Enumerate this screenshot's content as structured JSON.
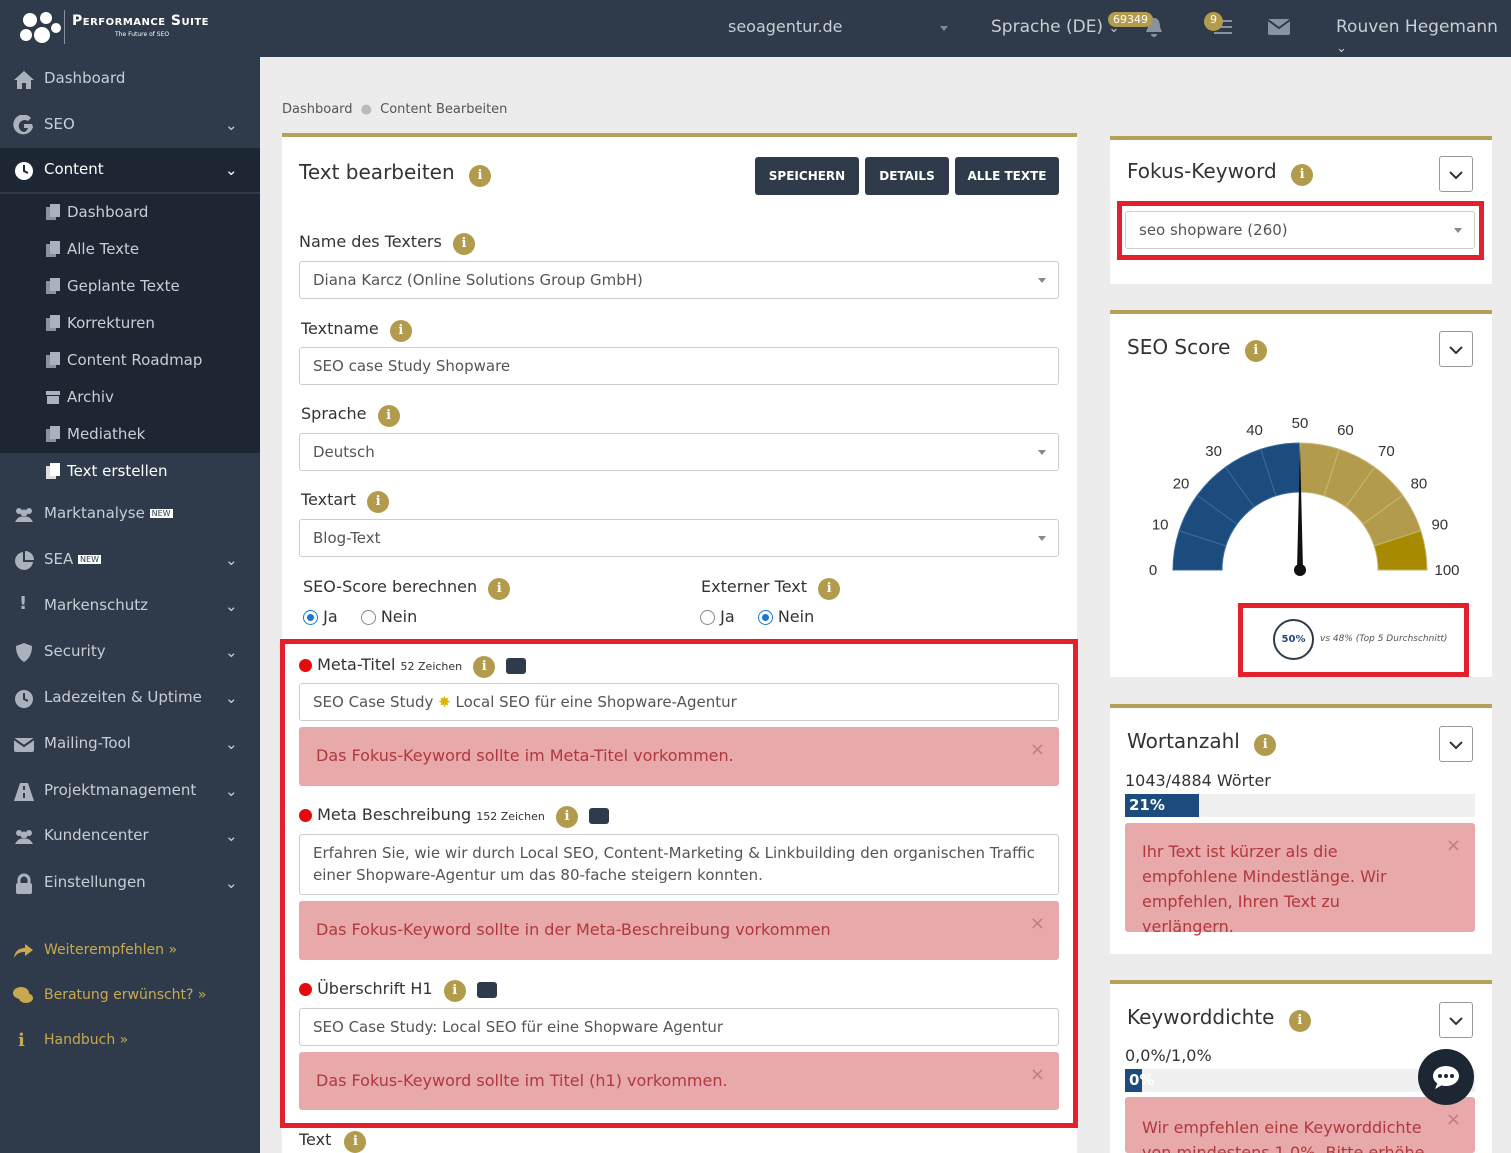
{
  "topbar": {
    "logo_title": "Performance Suite",
    "logo_subtitle": "The Future of SEO",
    "domain": "seoagentur.de",
    "language": "Sprache (DE)",
    "notif_count": "69349",
    "task_count": "9",
    "user": "Rouven Hegemann"
  },
  "sidebar": {
    "items": [
      {
        "label": "Dashboard",
        "icon": "home-icon"
      },
      {
        "label": "SEO",
        "icon": "google-icon"
      },
      {
        "label": "Content",
        "icon": "clock-icon"
      },
      {
        "label": "Marktanalyse",
        "icon": "users-icon",
        "badge": "NEW"
      },
      {
        "label": "SEA",
        "icon": "pie-chart-icon",
        "badge": "NEW"
      },
      {
        "label": "Markenschutz",
        "icon": "exclamation-icon"
      },
      {
        "label": "Security",
        "icon": "shield-icon"
      },
      {
        "label": "Ladezeiten & Uptime",
        "icon": "clock-icon"
      },
      {
        "label": "Mailing-Tool",
        "icon": "envelope-icon"
      },
      {
        "label": "Projektmanagement",
        "icon": "road-icon"
      },
      {
        "label": "Kundencenter",
        "icon": "users-icon"
      },
      {
        "label": "Einstellungen",
        "icon": "lock-icon"
      }
    ],
    "content_sub": [
      "Dashboard",
      "Alle Texte",
      "Geplante Texte",
      "Korrekturen",
      "Content Roadmap",
      "Archiv",
      "Mediathek",
      "Text erstellen"
    ],
    "links": [
      "Weiterempfehlen »",
      "Beratung erwünscht? »",
      "Handbuch »"
    ]
  },
  "breadcrumb": {
    "home": "Dashboard",
    "current": "Content Bearbeiten"
  },
  "editor": {
    "title": "Text bearbeiten",
    "buttons": {
      "save": "SPEICHERN",
      "details": "DETAILS",
      "all": "ALLE TEXTE"
    },
    "writer_label": "Name des Texters",
    "writer_value": "Diana Karcz (Online Solutions Group GmbH)",
    "textname_label": "Textname",
    "textname_value": "SEO case Study Shopware",
    "language_label": "Sprache",
    "language_value": "Deutsch",
    "texttype_label": "Textart",
    "texttype_value": "Blog-Text",
    "seo_score_label": "SEO-Score berechnen",
    "external_label": "Externer Text",
    "yes": "Ja",
    "no": "Nein",
    "meta_title_label": "Meta-Titel",
    "meta_title_count": "52 Zeichen",
    "meta_title_before": "SEO Case Study",
    "meta_title_after": "Local SEO für eine Shopware-Agentur",
    "meta_title_alert": "Das Fokus-Keyword sollte im Meta-Titel vorkommen.",
    "meta_desc_label": "Meta Beschreibung",
    "meta_desc_count": "152 Zeichen",
    "meta_desc_value": "Erfahren Sie, wie wir durch Local SEO, Content-Marketing & Linkbuilding den organischen Traffic einer Shopware-Agentur um das 80-fache steigern konnten.",
    "meta_desc_alert": "Das Fokus-Keyword sollte in der Meta-Beschreibung vorkommen",
    "h1_label": "Überschrift H1",
    "h1_value": "SEO Case Study: Local SEO für eine Shopware Agentur",
    "h1_alert": "Das Fokus-Keyword sollte im Titel (h1) vorkommen.",
    "text_label": "Text"
  },
  "focus": {
    "title": "Fokus-Keyword",
    "value": "seo shopware (260)"
  },
  "seo_score": {
    "title": "SEO Score",
    "value": 50,
    "ticks": [
      "0",
      "10",
      "20",
      "30",
      "40",
      "50",
      "60",
      "70",
      "80",
      "90",
      "100"
    ],
    "score_label": "50%",
    "compare": "vs 48% (Top 5 Durchschnitt)",
    "colors": {
      "low": "#1c4b7e",
      "high": "#b39b4e"
    }
  },
  "wordcount": {
    "title": "Wortanzahl",
    "counts": "1043/4884 Wörter",
    "percent": 21,
    "percent_label": "21%",
    "alert": "Ihr Text ist kürzer als die empfohlene Mindestlänge. Wir empfehlen, Ihren Text zu verlängern."
  },
  "keyword_density": {
    "title": "Keyworddichte",
    "value": "0,0%/1,0%",
    "percent_label": "0%",
    "alert": "Wir empfehlen eine Keyworddichte von mindestens 1,0%. Bitte erhöhe"
  }
}
